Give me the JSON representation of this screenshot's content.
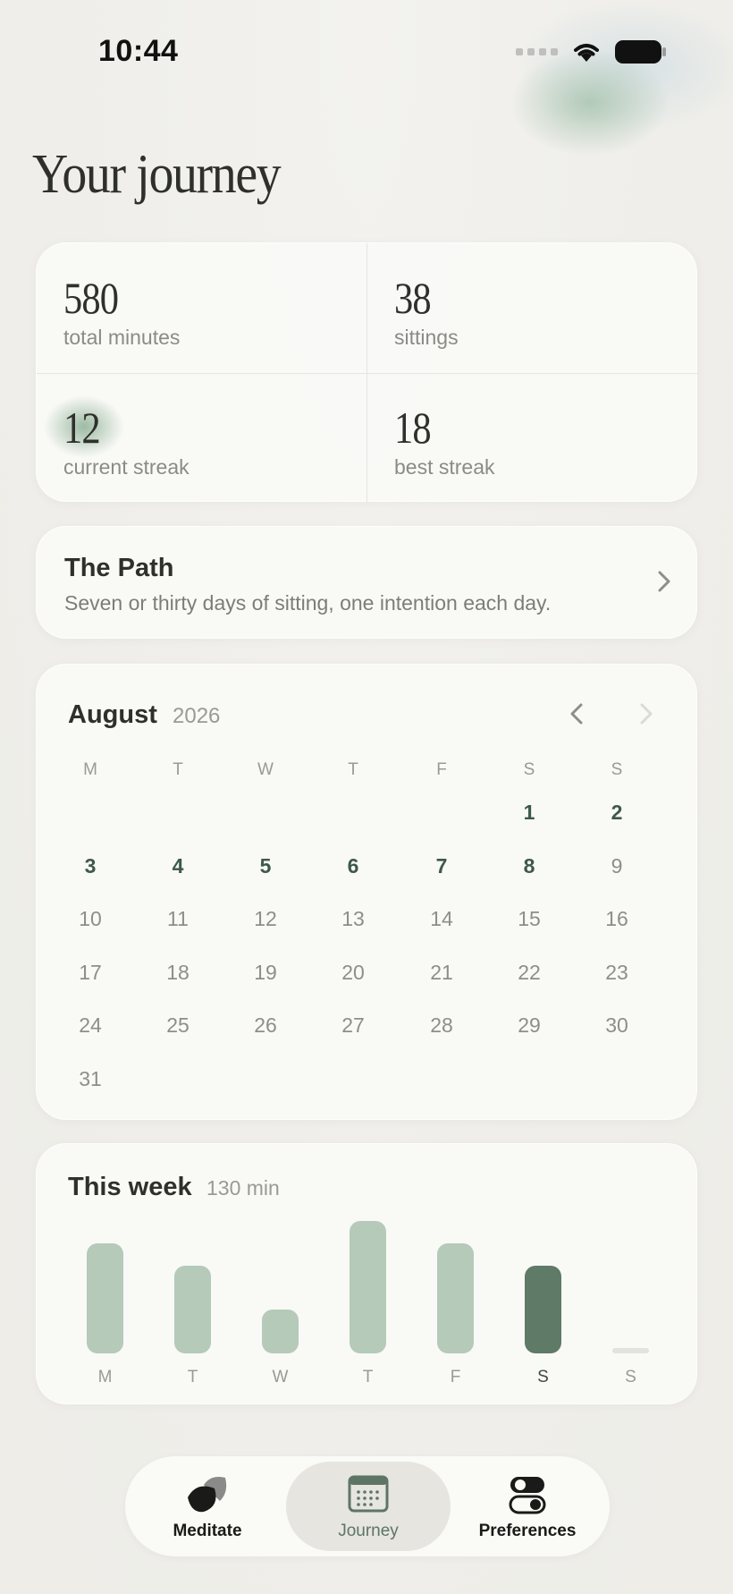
{
  "status_bar": {
    "time": "10:44"
  },
  "page": {
    "title": "Your journey"
  },
  "stats": [
    {
      "value": "580",
      "label": "total minutes"
    },
    {
      "value": "38",
      "label": "sittings"
    },
    {
      "value": "12",
      "label": "current streak"
    },
    {
      "value": "18",
      "label": "best streak"
    }
  ],
  "path_card": {
    "title": "The Path",
    "description": "Seven or thirty days of sitting, one intention each day."
  },
  "calendar": {
    "month": "August",
    "year": "2026",
    "weekdays": [
      "M",
      "T",
      "W",
      "T",
      "F",
      "S",
      "S"
    ],
    "days": [
      "1",
      "2",
      "3",
      "4",
      "5",
      "6",
      "7",
      "8",
      "9",
      "10",
      "11",
      "12",
      "13",
      "14",
      "15",
      "16",
      "17",
      "18",
      "19",
      "20",
      "21",
      "22",
      "23",
      "24",
      "25",
      "26",
      "27",
      "28",
      "29",
      "30",
      "31"
    ],
    "completed_days": [
      1,
      2,
      3,
      4,
      5,
      6,
      7
    ],
    "today": 8
  },
  "week": {
    "title": "This week",
    "total": "130 min",
    "labels": [
      "M",
      "T",
      "W",
      "T",
      "F",
      "S",
      "S"
    ],
    "minutes_relative": [
      0.83,
      0.66,
      0.33,
      1.0,
      0.83,
      0.66,
      0
    ],
    "today_index": 5
  },
  "tabs": [
    {
      "label": "Meditate",
      "icon": "leaf-icon"
    },
    {
      "label": "Journey",
      "icon": "calendar-icon"
    },
    {
      "label": "Preferences",
      "icon": "toggles-icon"
    }
  ],
  "colors": {
    "accent": "#5f7a66",
    "bar": "#b5cab9",
    "background": "#f1f0ec"
  }
}
